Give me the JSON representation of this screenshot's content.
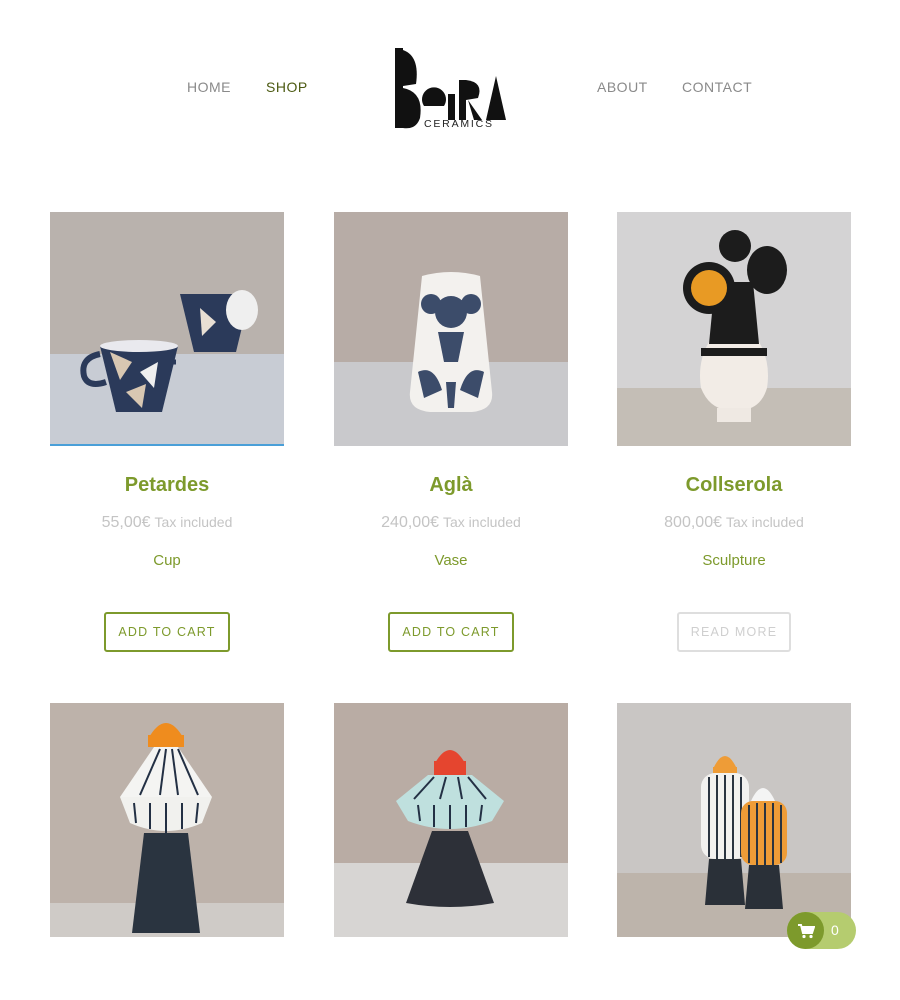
{
  "nav": {
    "home": "HOME",
    "shop": "SHOP",
    "about": "ABOUT",
    "contact": "CONTACT"
  },
  "logo": {
    "mark": "BOIRA",
    "subtitle": "CERAMICS"
  },
  "products": [
    {
      "name": "Petardes",
      "price": "55,00€",
      "tax": "Tax included",
      "category": "Cup",
      "button": "ADD TO CART",
      "button_state": "active"
    },
    {
      "name": "Aglà",
      "price": "240,00€",
      "tax": "Tax included",
      "category": "Vase",
      "button": "ADD TO CART",
      "button_state": "active"
    },
    {
      "name": "Collserola",
      "price": "800,00€",
      "tax": "Tax included",
      "category": "Sculpture",
      "button": "READ MORE",
      "button_state": "muted"
    }
  ],
  "cart": {
    "count": "0",
    "icon": "cart-icon"
  },
  "colors": {
    "accent": "#7d9a2c",
    "accent_light": "#b5cc6f",
    "nav_active": "#4c5a12",
    "nav": "#8a8a8a",
    "muted": "#c4c4c4"
  }
}
